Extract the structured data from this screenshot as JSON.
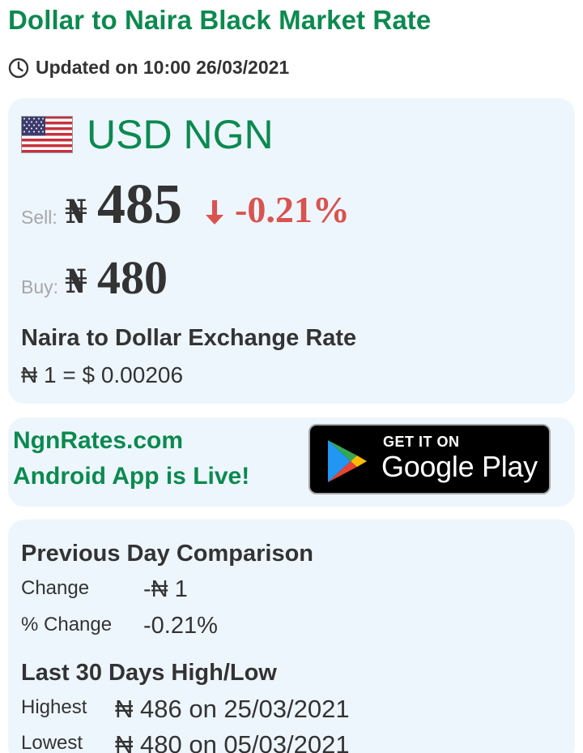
{
  "header": {
    "title": "Dollar to Naira Black Market Rate",
    "updated": "Updated on 10:00 26/03/2021"
  },
  "rate_card": {
    "pair": "USD NGN",
    "currency_symbol": "₦",
    "sell_label": "Sell:",
    "sell_value": "485",
    "change_pct": "-0.21%",
    "buy_label": "Buy:",
    "buy_value": "480",
    "conversion_heading": "Naira to Dollar Exchange Rate",
    "conversion_value": "₦ 1 = $ 0.00206"
  },
  "app_card": {
    "line1": "NgnRates.com",
    "line2": "Android App is Live!",
    "badge_top": "GET IT ON",
    "badge_main": "Google Play"
  },
  "stats_card": {
    "comparison_heading": "Previous Day Comparison",
    "change_label": "Change",
    "change_value": "-₦ 1",
    "pct_change_label": "% Change",
    "pct_change_value": "-0.21%",
    "highlow_heading": "Last 30 Days High/Low",
    "highest_label": "Highest",
    "highest_value": "₦ 486 on 25/03/2021",
    "lowest_label": "Lowest",
    "lowest_value": "₦ 480 on 05/03/2021"
  },
  "colors": {
    "brand_green": "#0b8a4f",
    "down_red": "#d9534f",
    "card_bg": "#eef6fd"
  },
  "icons": {
    "clock": "clock-icon",
    "flag": "us-flag-icon",
    "down": "arrow-down-icon",
    "play": "google-play-logo-icon"
  }
}
